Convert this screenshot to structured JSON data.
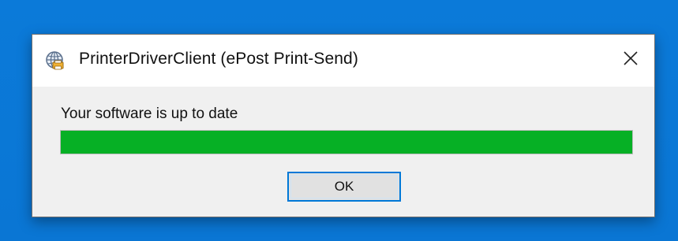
{
  "window": {
    "title": "PrinterDriverClient (ePost Print-Send)",
    "app_icon": "globe-printer-icon",
    "close_icon": "close-icon"
  },
  "content": {
    "status_text": "Your software is up to date",
    "progress_fraction": 1.0,
    "progress_color": "#06b025"
  },
  "buttons": {
    "ok_label": "OK"
  },
  "colors": {
    "desktop": "#0a78d7",
    "accent": "#0078d7"
  }
}
